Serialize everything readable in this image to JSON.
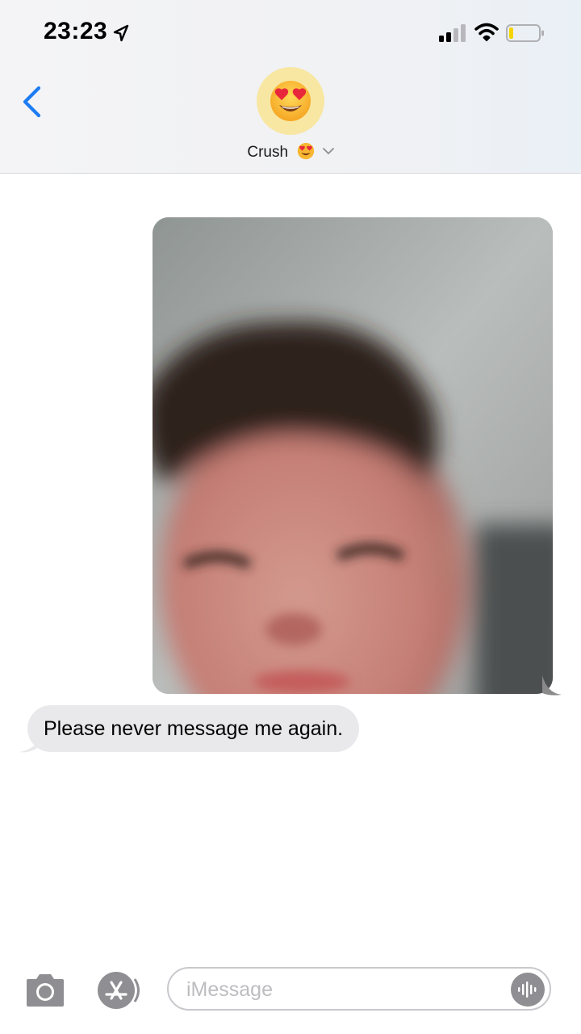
{
  "status_bar": {
    "time": "23:23",
    "icons": [
      "location-arrow-icon",
      "cellular-signal-icon",
      "wifi-icon",
      "battery-low-icon"
    ]
  },
  "nav": {
    "back_icon": "chevron-left-icon",
    "contact_name": "Crush",
    "contact_emoji": "heart-eyes-emoji",
    "accent_color": "#1e7cf2"
  },
  "thread": {
    "outgoing_photo": {
      "type": "photo",
      "description_icon": "photo"
    },
    "incoming_message": "Please never message me again."
  },
  "input_bar": {
    "camera_icon": "camera-icon",
    "apps_icon": "app-store-icon",
    "placeholder": "iMessage",
    "value": "",
    "dictation_icon": "waveform-icon"
  },
  "colors": {
    "incoming_bubble": "#e9e9eb",
    "avatar_bg": "#f8e7a3",
    "icon_gray": "#8e8e93"
  }
}
